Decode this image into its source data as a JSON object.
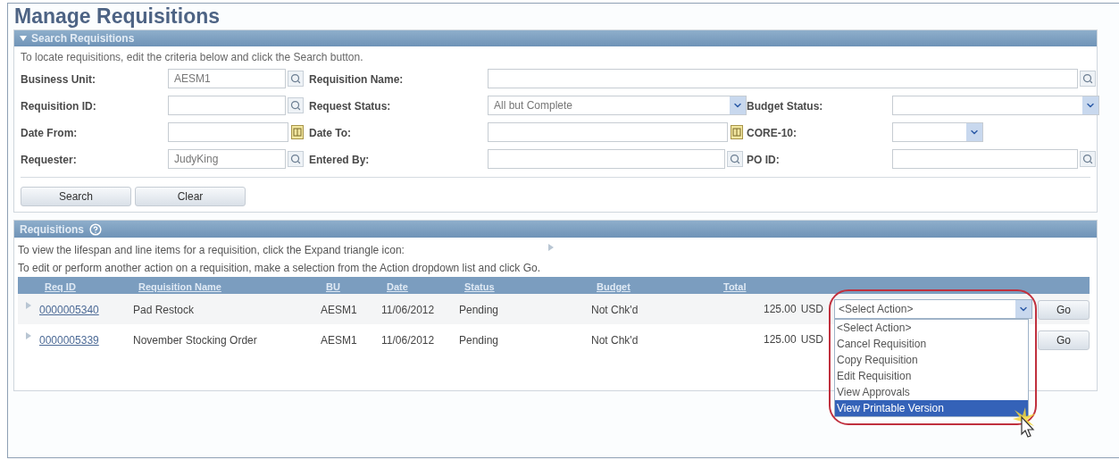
{
  "title": "Manage Requisitions",
  "search_section": {
    "title": "Search Requisitions",
    "expanded": true,
    "instructions": "To locate requisitions, edit the criteria below and click the Search button.",
    "field_rows": [
      {
        "fields": [
          {
            "label": "Business Unit:",
            "kind": "lookup",
            "value": "AESM1"
          },
          {
            "label": "Requisition Name:",
            "kind": "lookup"
          }
        ]
      },
      {
        "fields": [
          {
            "label": "Requisition ID:",
            "kind": "lookup"
          },
          {
            "label": "Request Status:",
            "kind": "select",
            "value": "All but Complete"
          },
          {
            "label": "Budget Status:",
            "kind": "select"
          }
        ]
      },
      {
        "fields": [
          {
            "label": "Date From:",
            "kind": "date"
          },
          {
            "label": "Date To:",
            "kind": "date"
          },
          {
            "label": "CORE-10:",
            "kind": "small-select"
          }
        ]
      },
      {
        "fields": [
          {
            "label": "Requester:",
            "kind": "lookup",
            "value": "JudyKing"
          },
          {
            "label": "Entered By:",
            "kind": "lookup"
          },
          {
            "label": "PO ID:",
            "kind": "lookup"
          }
        ]
      }
    ],
    "buttons": [
      "Search",
      "Clear"
    ]
  },
  "requisitions_section": {
    "title": "Requisitions",
    "instructions": [
      "To view the lifespan and line items for a requisition, click the Expand triangle icon:",
      "To edit or perform another action on a requisition, make a selection from the Action dropdown list and click Go."
    ],
    "columns": [
      "Req ID",
      "Requisition Name",
      "BU",
      "Date",
      "Status",
      "Budget",
      "Total"
    ],
    "rows": [
      {
        "expanded": false,
        "req_id": "0000005340",
        "name": "Pad Restock",
        "bu": "AESM1",
        "date": "11/06/2012",
        "status": "Pending",
        "budget": "Not Chk'd",
        "total": "125.00",
        "currency": "USD",
        "action": "<Select Action>",
        "go": "Go"
      },
      {
        "expanded": false,
        "req_id": "0000005339",
        "name": "November Stocking Order",
        "bu": "AESM1",
        "date": "11/06/2012",
        "status": "Pending",
        "budget": "Not Chk'd",
        "total": "125.00",
        "currency": "USD",
        "go": "Go"
      }
    ],
    "action_menu": {
      "options": [
        {
          "label": "<Select Action>",
          "selected": false
        },
        {
          "label": "Cancel Requisition",
          "selected": false
        },
        {
          "label": "Copy Requisition",
          "selected": false
        },
        {
          "label": "Edit Requisition",
          "selected": false
        },
        {
          "label": "View Approvals",
          "selected": false
        },
        {
          "label": "View Printable Version",
          "selected": true
        }
      ]
    }
  }
}
